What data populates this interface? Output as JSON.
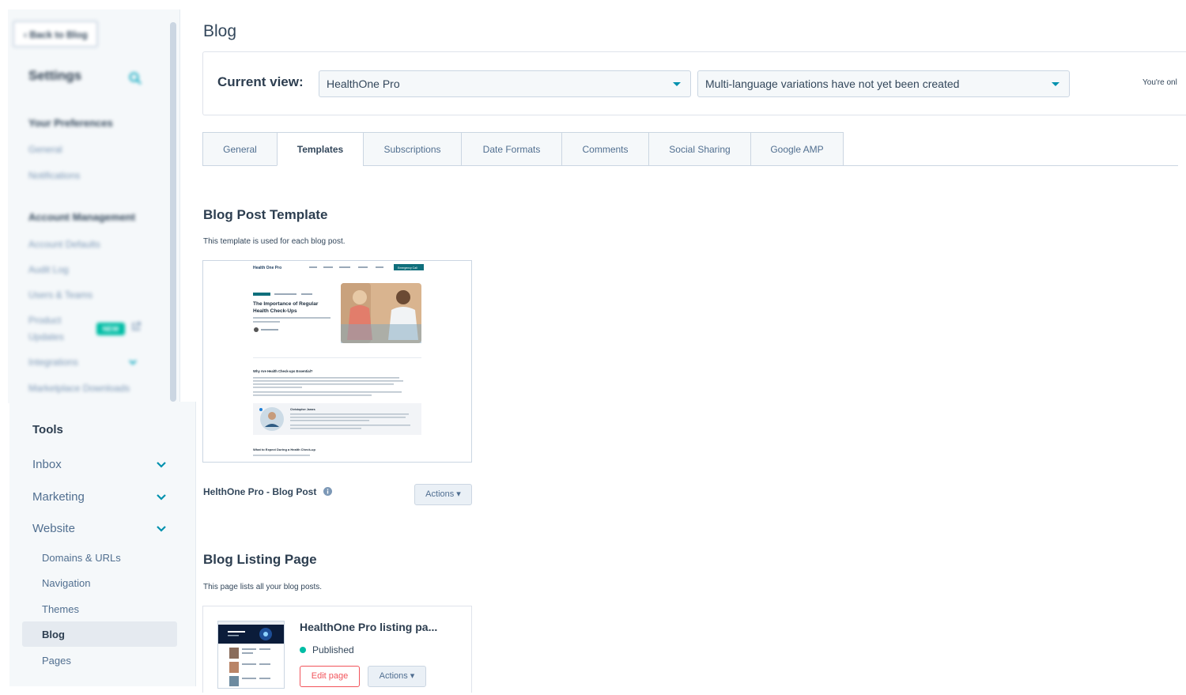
{
  "sidebar": {
    "back_label": "‹ Back to Blog",
    "settings_title": "Settings",
    "preferences_heading": "Your Preferences",
    "general": "General",
    "notifications": "Notifications",
    "account_heading": "Account Management",
    "account_defaults": "Account Defaults",
    "audit_log": "Audit Log",
    "users_teams": "Users & Teams",
    "product_updates_1": "Product",
    "product_updates_2": "Updates",
    "new_badge": "NEW",
    "integrations": "Integrations",
    "marketplace": "Marketplace Downloads"
  },
  "tools": {
    "title": "Tools",
    "items": [
      "Inbox",
      "Marketing",
      "Website"
    ],
    "sub_items": [
      "Domains & URLs",
      "Navigation",
      "Themes",
      "Blog",
      "Pages"
    ]
  },
  "main": {
    "title": "Blog",
    "current_view_label": "Current view:",
    "blog_select": "HealthOne Pro",
    "language_select": "Multi-language variations have not yet been created",
    "view_note": "You're onl",
    "tabs": [
      "General",
      "Templates",
      "Subscriptions",
      "Date Formats",
      "Comments",
      "Social Sharing",
      "Google AMP"
    ],
    "active_tab": "Templates",
    "post_template": {
      "title": "Blog Post Template",
      "description": "This template is used for each blog post.",
      "name": "HelthOne Pro - Blog Post",
      "actions_label": "Actions ▾"
    },
    "listing": {
      "title": "Blog Listing Page",
      "description": "This page lists all your blog posts.",
      "name": "HealthOne Pro listing pa...",
      "status": "Published",
      "edit_label": "Edit page",
      "actions_label": "Actions ▾"
    },
    "preview": {
      "logo": "Health One Pro",
      "cta": "Emergency Call",
      "post_title_1": "The Importance of Regular",
      "post_title_2": "Health Check-Ups",
      "h2_1": "Why Are Health Check-ups Essential?",
      "author": "Christopher James",
      "h2_2": "What to Expect During a Health Check-up"
    }
  },
  "colors": {
    "accent": "#0091ae",
    "teal": "#00bda5",
    "danger": "#f2545b",
    "text": "#33475b"
  }
}
